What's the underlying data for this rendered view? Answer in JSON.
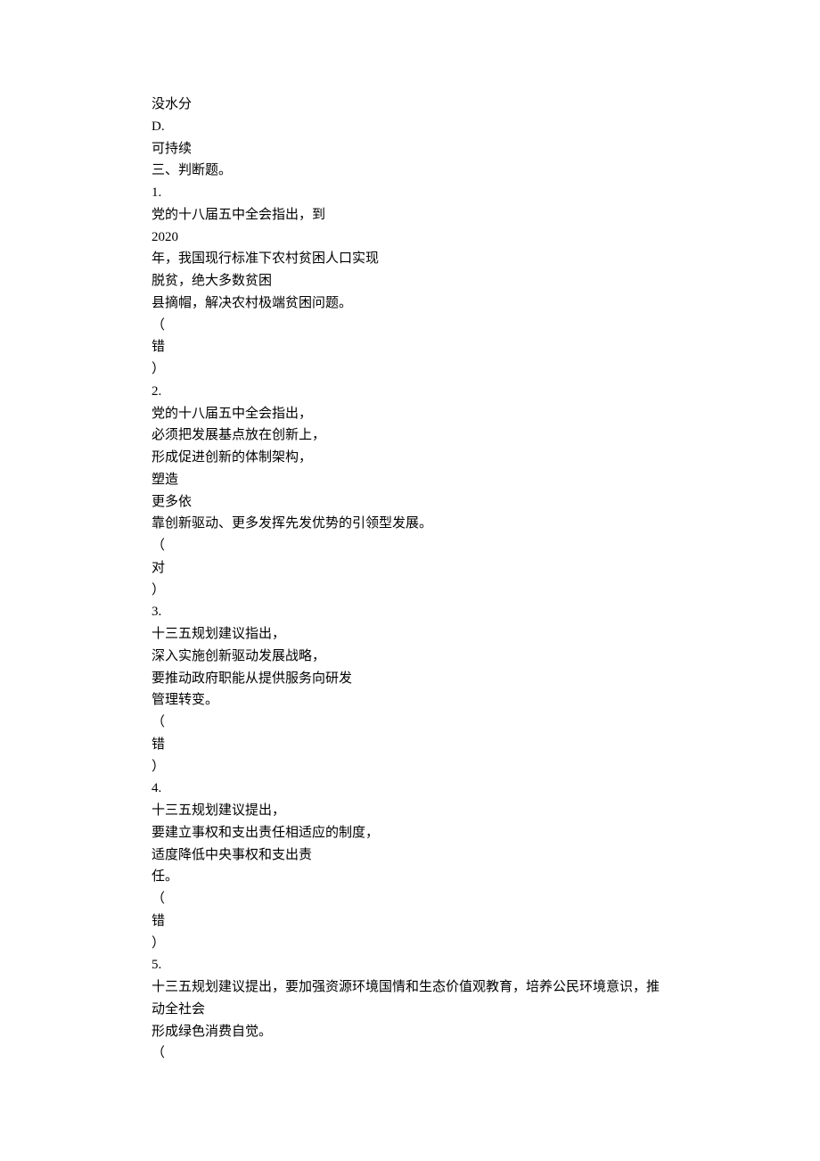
{
  "lines": [
    "没水分",
    "D.",
    "可持续",
    "三、判断题。",
    "1.",
    "党的十八届五中全会指出，到",
    "2020",
    "年，我国现行标准下农村贫困人口实现",
    "脱贫，绝大多数贫困",
    "县摘帽，解决农村极端贫困问题。",
    "（",
    "错",
    "）",
    "2.",
    "党的十八届五中全会指出，",
    "必须把发展基点放在创新上，",
    "形成促进创新的体制架构，",
    "塑造",
    "更多依",
    "靠创新驱动、更多发挥先发优势的引领型发展。",
    "（",
    "对",
    "）",
    "3.",
    "十三五规划建议指出，",
    "深入实施创新驱动发展战略，",
    "要推动政府职能从提供服务向研发",
    "管理转变。",
    "（",
    "错",
    "）",
    "4.",
    "十三五规划建议提出，",
    "要建立事权和支出责任相适应的制度，",
    "适度降低中央事权和支出责",
    "任。",
    "（",
    "错",
    "）",
    "5.",
    "十三五规划建议提出，要加强资源环境国情和生态价值观教育，培养公民环境意识，推动全社会",
    "形成绿色消费自觉。",
    "（"
  ]
}
